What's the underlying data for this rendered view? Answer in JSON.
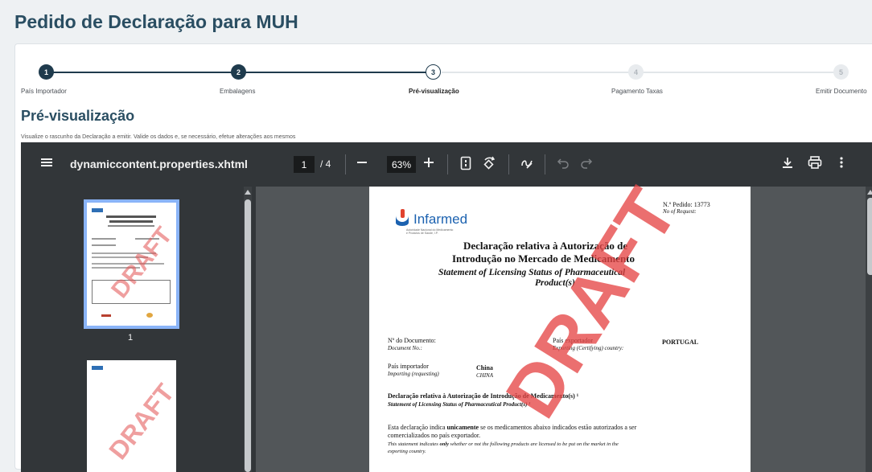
{
  "page_title": "Pedido de Declaração para MUH",
  "stepper": {
    "steps": [
      {
        "number": "1",
        "label": "País Importador",
        "state": "done"
      },
      {
        "number": "2",
        "label": "Embalagens",
        "state": "done"
      },
      {
        "number": "3",
        "label": "Pré-visualização",
        "state": "active"
      },
      {
        "number": "4",
        "label": "Pagamento Taxas",
        "state": "todo"
      },
      {
        "number": "5",
        "label": "Emitir Documento",
        "state": "todo"
      }
    ]
  },
  "section": {
    "title": "Pré-visualização",
    "subtitle": "Visualize o rascunho da Declaração a emitir. Valide os dados e, se necessário, efetue alterações aos mesmos"
  },
  "viewer": {
    "file_name": "dynamiccontent.properties.xhtml",
    "current_page": "1",
    "total_pages": "/ 4",
    "zoom": "63%",
    "thumb_page_label": "1",
    "thumb_watermark": "DRAFT",
    "icons": [
      "menu-icon",
      "zoom-out-icon",
      "zoom-in-icon",
      "fit-page-icon",
      "rotate-icon",
      "annotate-icon",
      "undo-icon",
      "redo-icon",
      "download-icon",
      "print-icon",
      "more-icon"
    ]
  },
  "document": {
    "logo_text": "Infarmed",
    "logo_sub1": "Autoridade Nacional do Medicamento",
    "logo_sub2": "e Produtos de Saúde, I.P.",
    "request_label": "N.º Pedido: 13773",
    "request_label_en": "No of Request:",
    "title_pt_1": "Declaração relativa à Autorização de",
    "title_pt_2": "Introdução no Mercado de Medicamento",
    "title_en_1": "Statement of Licensing Status of Pharmaceutical",
    "title_en_2": "Product(s)",
    "doc_no_label": "Nº do Documento:",
    "doc_no_label_en": "Document No.:",
    "exporter_label": "País exportador",
    "exporter_label_en": "Exporting (Certifying) country:",
    "exporter_value": "PORTUGAL",
    "importer_label": "País importador",
    "importer_label_en": "Importing (requesting)",
    "importer_value": "China",
    "importer_value_en": "CHINA",
    "decl_heading": "Declaração relativa à Autorização de Introdução de Medicamento(s) ¹",
    "decl_heading_en": "Statement of Licensing Status of Pharmaceutical Product(s) ¹",
    "para_pt_1_a": "Esta declaração indica ",
    "para_pt_1_b": "unicamente",
    "para_pt_1_c": " se os medicamentos abaixo indicados estão autorizados a ser",
    "para_pt_2": "comercializados no país exportador.",
    "para_en_1_a": "This statement indicates ",
    "para_en_1_b": "only",
    "para_en_1_c": " whether or not the following products are licensed to be put on the market in the",
    "para_en_2": "exporting country.",
    "watermark": "DRAFT"
  },
  "colors": {
    "title": "#2a4e62",
    "step_done": "#1f3b4d",
    "toolbar": "#323639",
    "viewer_bg": "#525659",
    "thumb_selected": "#8ab4f8",
    "watermark": "#e64646"
  }
}
